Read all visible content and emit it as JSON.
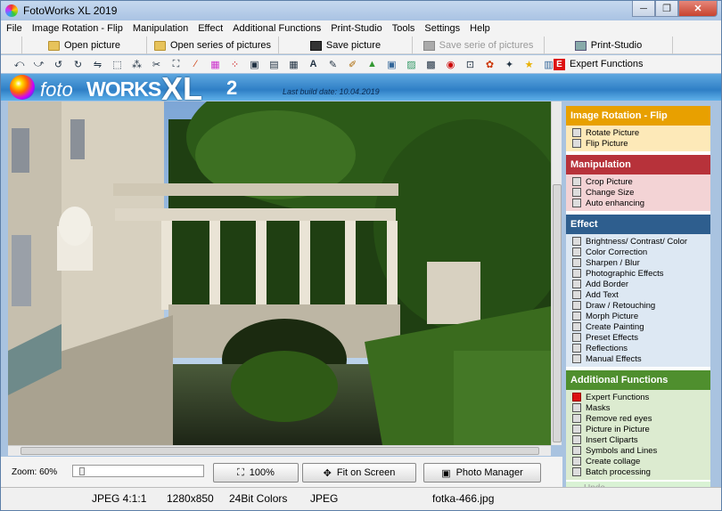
{
  "window": {
    "title": "FotoWorks XL 2019",
    "controls": [
      "─",
      "❐",
      "✕"
    ]
  },
  "menu": [
    "File",
    "Image Rotation - Flip",
    "Manipulation",
    "Effect",
    "Additional Functions",
    "Print-Studio",
    "Tools",
    "Settings",
    "Help"
  ],
  "toolbar1": {
    "open": "Open picture",
    "open_series": "Open series of pictures",
    "save": "Save picture",
    "save_series": "Save serie of pictures",
    "print": "Print-Studio"
  },
  "toolbar2": {
    "icons": [
      "rotate-left",
      "rotate-right",
      "rotate-ccw",
      "rotate-cw",
      "flip",
      "perspective",
      "sharpen",
      "crop",
      "resize",
      "color-wand",
      "palette",
      "channels",
      "frame",
      "photo",
      "mosaic",
      "text",
      "brush",
      "pen",
      "landscape",
      "picture",
      "image-tools",
      "collage",
      "redeye",
      "picture-in-picture",
      "gift",
      "clipart",
      "star",
      "batch"
    ],
    "glyphs": [
      "⤺",
      "⤻",
      "↺",
      "↻",
      "⇋",
      "⬚",
      "⁂",
      "✂",
      "⛶",
      "⁄",
      "▦",
      "⁘",
      "▣",
      "▤",
      "▦",
      "A",
      "✎",
      "✐",
      "▲",
      "▣",
      "▨",
      "▩",
      "◉",
      "⊡",
      "✿",
      "✦",
      "★",
      "▥"
    ],
    "expert": "Expert Functions",
    "expert_badge": "E"
  },
  "banner": {
    "foto": "foto",
    "works": "WORKS",
    "xl": "XL",
    "version": "2",
    "build": "Last build date:  10.04.2019"
  },
  "bottom": {
    "zoom_label": "Zoom: 60%",
    "zoom_value": 0.02,
    "btn_100": "100%",
    "btn_fit": "Fit on Screen",
    "btn_manager": "Photo Manager"
  },
  "panel": {
    "rotation": {
      "title": "Image Rotation - Flip",
      "color": "#e8a000",
      "bg": "#fde9b8",
      "items": [
        "Rotate Picture",
        "Flip Picture"
      ]
    },
    "manipulation": {
      "title": "Manipulation",
      "color": "#b7323a",
      "bg": "#f3d3d5",
      "items": [
        "Crop Picture",
        "Change Size",
        "Auto enhancing"
      ]
    },
    "effect": {
      "title": "Effect",
      "color": "#2e5e8e",
      "bg": "#dde8f3",
      "items": [
        "Brightness/ Contrast/ Color",
        "Color Correction",
        "Sharpen / Blur",
        "Photographic Effects",
        "Add Border",
        "Add Text",
        "Draw / Retouching",
        "Morph Picture",
        "Create Painting",
        "Preset Effects",
        "Reflections",
        "Manual Effects"
      ]
    },
    "additional": {
      "title": "Additional Functions",
      "color": "#4f8f2e",
      "bg": "#dcebd0",
      "items": [
        "Expert Functions",
        "Masks",
        "Remove red eyes",
        "Picture in Picture",
        "Insert Cliparts",
        "Symbols and Lines",
        "Create collage",
        "Batch processing"
      ]
    },
    "undo": "Undo"
  },
  "status": {
    "format": "JPEG  4:1:1",
    "dimensions": "1280x850",
    "colors": "24Bit Colors",
    "type": "JPEG",
    "filename": "fotka-466.jpg"
  }
}
